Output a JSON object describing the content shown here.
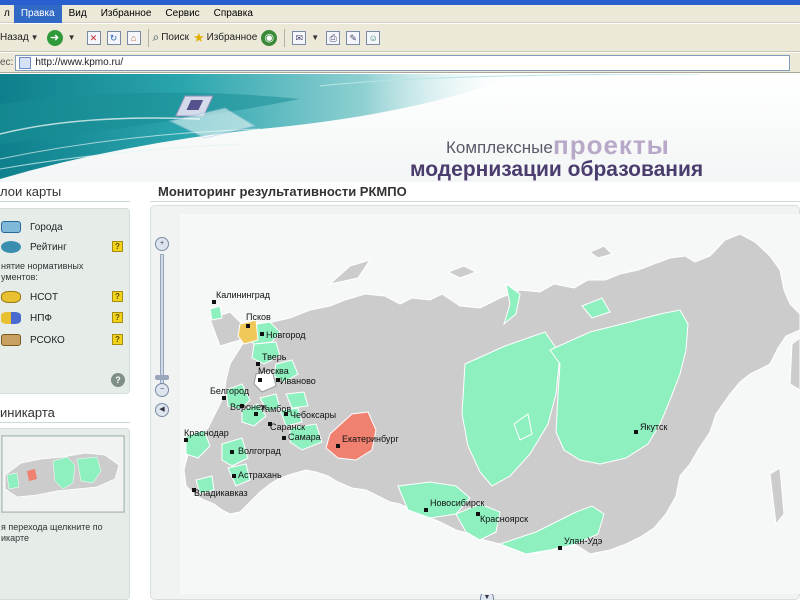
{
  "browser": {
    "menu": [
      "Правка",
      "Вид",
      "Избранное",
      "Сервис",
      "Справка"
    ],
    "active_menu": "Правка",
    "toolbar": {
      "back": "Назад",
      "search": "Поиск",
      "favorites": "Избранное"
    },
    "address": {
      "label": "ес:",
      "url": "http://www.kpmo.ru/"
    }
  },
  "banner": {
    "brand_line1": "Комплексные",
    "brand_line2": "проекты",
    "brand_line3": "модернизации образования"
  },
  "sidebar": {
    "layers_title": "лои карты",
    "layers": [
      {
        "label": "Города",
        "icon": "cities-icon",
        "has_help": false
      },
      {
        "label": "Рейтинг",
        "icon": "rating-icon",
        "has_help": true
      }
    ],
    "adoption_label": "нятие нормативных\nументов:",
    "docs": [
      {
        "label": "НСОТ",
        "icon": "coins-icon"
      },
      {
        "label": "НПФ",
        "icon": "coins-chart-icon"
      },
      {
        "label": "РСОКО",
        "icon": "stack-icon"
      }
    ],
    "minimap_title": "иникарта",
    "minimap_note": "я перехода щелкните по\nикарте"
  },
  "main": {
    "title": "Мониторинг результативности РКМПО"
  },
  "map": {
    "colors": {
      "base": "#cccccc",
      "participant": "#8ef0bf",
      "highlight_orange": "#f08070",
      "highlight_yellow": "#f0c85a",
      "highlight_white": "#ffffff",
      "border": "#ffffff"
    },
    "cities": [
      {
        "name": "Калининград"
      },
      {
        "name": "Псков"
      },
      {
        "name": "Новгород"
      },
      {
        "name": "Тверь"
      },
      {
        "name": "Москва"
      },
      {
        "name": "Иваново"
      },
      {
        "name": "Белгород"
      },
      {
        "name": "Воронеж"
      },
      {
        "name": "Тамбов"
      },
      {
        "name": "Чебоксары"
      },
      {
        "name": "Саранск"
      },
      {
        "name": "Самара"
      },
      {
        "name": "Краснодар"
      },
      {
        "name": "Волгоград"
      },
      {
        "name": "Астрахань"
      },
      {
        "name": "Владикавказ"
      },
      {
        "name": "Екатеринбург"
      },
      {
        "name": "Новосибирск"
      },
      {
        "name": "Красноярск"
      },
      {
        "name": "Улан-Удэ"
      },
      {
        "name": "Якутск"
      }
    ]
  }
}
